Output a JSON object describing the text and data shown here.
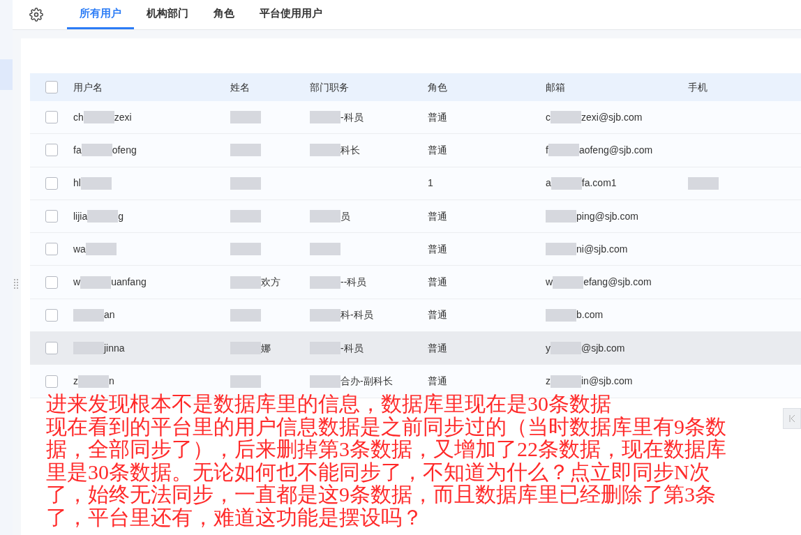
{
  "tabs": [
    {
      "label": "所有用户",
      "selected": true
    },
    {
      "label": "机构部门",
      "selected": false
    },
    {
      "label": "角色",
      "selected": false
    },
    {
      "label": "平台使用用户",
      "selected": false
    }
  ],
  "table": {
    "all_checked": false,
    "columns": [
      "用户名",
      "姓名",
      "部门职务",
      "角色",
      "邮箱",
      "手机"
    ],
    "rows": [
      {
        "checked": false,
        "highlighted": false,
        "cells": [
          [
            {
              "kind": "text",
              "text": "ch"
            },
            {
              "kind": "redacted"
            },
            {
              "kind": "text",
              "text": "zexi"
            }
          ],
          [
            {
              "kind": "redacted"
            }
          ],
          [
            {
              "kind": "redacted"
            },
            {
              "kind": "text",
              "text": "-科员"
            }
          ],
          [
            {
              "kind": "text",
              "text": "普通"
            }
          ],
          [
            {
              "kind": "text",
              "text": "c"
            },
            {
              "kind": "redacted"
            },
            {
              "kind": "text",
              "text": "zexi@sjb.com"
            }
          ],
          []
        ]
      },
      {
        "checked": false,
        "highlighted": false,
        "cells": [
          [
            {
              "kind": "text",
              "text": "fa"
            },
            {
              "kind": "redacted"
            },
            {
              "kind": "text",
              "text": "ofeng"
            }
          ],
          [
            {
              "kind": "redacted"
            }
          ],
          [
            {
              "kind": "redacted"
            },
            {
              "kind": "text",
              "text": "科长"
            }
          ],
          [
            {
              "kind": "text",
              "text": "普通"
            }
          ],
          [
            {
              "kind": "text",
              "text": "f"
            },
            {
              "kind": "redacted"
            },
            {
              "kind": "text",
              "text": "aofeng@sjb.com"
            }
          ],
          []
        ]
      },
      {
        "checked": false,
        "highlighted": false,
        "cells": [
          [
            {
              "kind": "text",
              "text": "hl"
            },
            {
              "kind": "redacted"
            }
          ],
          [
            {
              "kind": "redacted"
            }
          ],
          [],
          [
            {
              "kind": "text",
              "text": "1"
            }
          ],
          [
            {
              "kind": "text",
              "text": "a"
            },
            {
              "kind": "redacted"
            },
            {
              "kind": "text",
              "text": "fa.com1"
            }
          ],
          [
            {
              "kind": "redacted"
            }
          ]
        ]
      },
      {
        "checked": false,
        "highlighted": false,
        "cells": [
          [
            {
              "kind": "text",
              "text": "lijia"
            },
            {
              "kind": "redacted"
            },
            {
              "kind": "text",
              "text": "g"
            }
          ],
          [
            {
              "kind": "redacted"
            }
          ],
          [
            {
              "kind": "redacted"
            },
            {
              "kind": "text",
              "text": "员"
            }
          ],
          [
            {
              "kind": "text",
              "text": "普通"
            }
          ],
          [
            {
              "kind": "redacted"
            },
            {
              "kind": "text",
              "text": "ping@sjb.com"
            }
          ],
          []
        ]
      },
      {
        "checked": false,
        "highlighted": false,
        "cells": [
          [
            {
              "kind": "text",
              "text": "wa"
            },
            {
              "kind": "redacted"
            }
          ],
          [
            {
              "kind": "redacted"
            }
          ],
          [
            {
              "kind": "redacted"
            }
          ],
          [
            {
              "kind": "text",
              "text": "普通"
            }
          ],
          [
            {
              "kind": "redacted"
            },
            {
              "kind": "text",
              "text": "ni@sjb.com"
            }
          ],
          []
        ]
      },
      {
        "checked": false,
        "highlighted": false,
        "cells": [
          [
            {
              "kind": "text",
              "text": "w"
            },
            {
              "kind": "redacted"
            },
            {
              "kind": "text",
              "text": "uanfang"
            }
          ],
          [
            {
              "kind": "redacted"
            },
            {
              "kind": "text",
              "text": "欢方"
            }
          ],
          [
            {
              "kind": "redacted"
            },
            {
              "kind": "text",
              "text": "--科员"
            }
          ],
          [
            {
              "kind": "text",
              "text": "普通"
            }
          ],
          [
            {
              "kind": "text",
              "text": "w"
            },
            {
              "kind": "redacted"
            },
            {
              "kind": "text",
              "text": "efang@sjb.com"
            }
          ],
          []
        ]
      },
      {
        "checked": false,
        "highlighted": false,
        "cells": [
          [
            {
              "kind": "redacted"
            },
            {
              "kind": "text",
              "text": "an"
            }
          ],
          [
            {
              "kind": "redacted"
            }
          ],
          [
            {
              "kind": "redacted"
            },
            {
              "kind": "text",
              "text": "科-科员"
            }
          ],
          [
            {
              "kind": "text",
              "text": "普通"
            }
          ],
          [
            {
              "kind": "redacted"
            },
            {
              "kind": "text",
              "text": "b.com"
            }
          ],
          []
        ]
      },
      {
        "checked": false,
        "highlighted": true,
        "cells": [
          [
            {
              "kind": "redacted"
            },
            {
              "kind": "text",
              "text": "jinna"
            }
          ],
          [
            {
              "kind": "redacted"
            },
            {
              "kind": "text",
              "text": "娜"
            }
          ],
          [
            {
              "kind": "redacted"
            },
            {
              "kind": "text",
              "text": "-科员"
            }
          ],
          [
            {
              "kind": "text",
              "text": "普通"
            }
          ],
          [
            {
              "kind": "text",
              "text": "y"
            },
            {
              "kind": "redacted"
            },
            {
              "kind": "text",
              "text": "@sjb.com"
            }
          ],
          []
        ]
      },
      {
        "checked": false,
        "highlighted": false,
        "cells": [
          [
            {
              "kind": "text",
              "text": "z"
            },
            {
              "kind": "redacted"
            },
            {
              "kind": "text",
              "text": "n"
            }
          ],
          [
            {
              "kind": "redacted"
            }
          ],
          [
            {
              "kind": "redacted"
            },
            {
              "kind": "text",
              "text": "合办-副科长"
            }
          ],
          [
            {
              "kind": "text",
              "text": "普通"
            }
          ],
          [
            {
              "kind": "text",
              "text": "z"
            },
            {
              "kind": "redacted"
            },
            {
              "kind": "text",
              "text": "in@sjb.com"
            }
          ],
          []
        ]
      }
    ]
  },
  "annotation": {
    "lines": [
      "进来发现根本不是数据库里的信息，数据库里现在是30条数据",
      "现在看到的平台里的用户信息数据是之前同步过的（当时数据库里有9条数",
      "据，全部同步了），后来删掉第3条数据，又增加了22条数据，现在数据库",
      "里是30条数据。无论如何也不能同步了，不知道为什么？点立即同步N次",
      "了，始终无法同步，一直都是这9条数据，而且数据库里已经删除了第3条",
      "了，平台里还有，难道这功能是摆设吗？"
    ]
  }
}
